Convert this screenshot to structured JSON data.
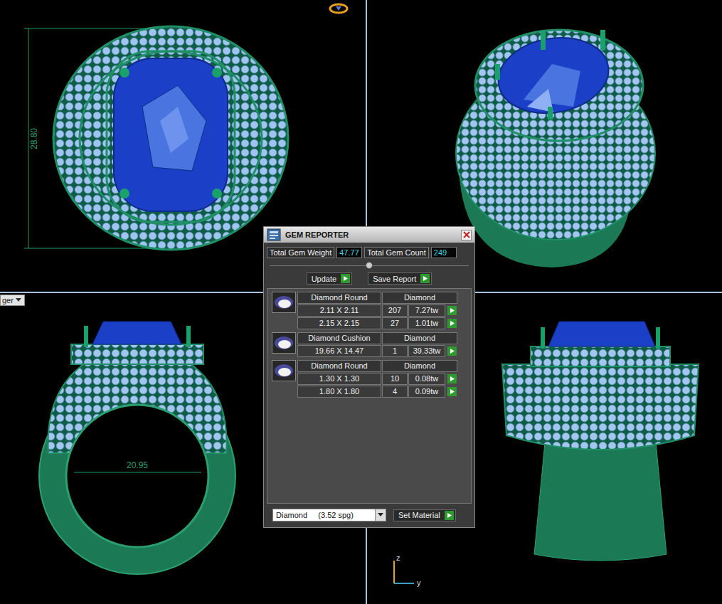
{
  "viewport_tab": {
    "label": "ger"
  },
  "dimensions": {
    "height": "28.80",
    "inner_diameter": "20.95"
  },
  "axes": {
    "vertical": "z",
    "horizontal": "y"
  },
  "gem_reporter": {
    "title": "GEM REPORTER",
    "totals": [
      {
        "label": "Total Gem Weight",
        "value": "47.77"
      },
      {
        "label": "Total Gem Count",
        "value": "249"
      }
    ],
    "buttons": [
      "Update",
      "Save Report"
    ],
    "groups": [
      {
        "shape": "Diamond Round",
        "material": "Diamond",
        "rows": [
          {
            "size": "2.11 X 2.11",
            "count": "207",
            "weight": "7.27tw"
          },
          {
            "size": "2.15 X 2.15",
            "count": "27",
            "weight": "1.01tw"
          }
        ]
      },
      {
        "shape": "Diamond Cushion",
        "material": "Diamond",
        "rows": [
          {
            "size": "19.66 X 14.47",
            "count": "1",
            "weight": "39.33tw"
          }
        ]
      },
      {
        "shape": "Diamond Round",
        "material": "Diamond",
        "rows": [
          {
            "size": "1.30 X 1.30",
            "count": "10",
            "weight": "0.08tw"
          },
          {
            "size": "1.80 X 1.80",
            "count": "4",
            "weight": "0.09tw"
          }
        ]
      }
    ],
    "material_select": {
      "value": "Diamond     (3.52 spg)"
    },
    "set_material": "Set Material"
  }
}
